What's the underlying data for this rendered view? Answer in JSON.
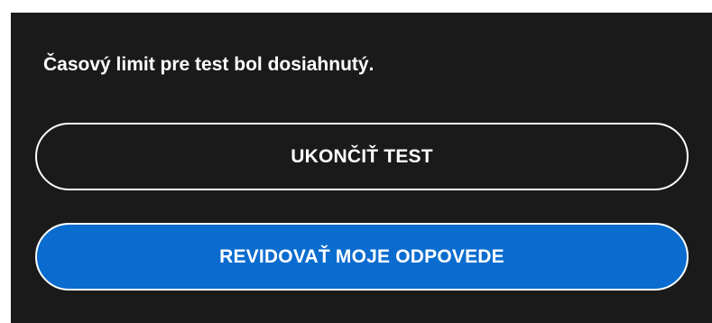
{
  "dialog": {
    "message": "Časový limit pre test bol dosiahnutý.",
    "end_test_label": "UKONČIŤ TEST",
    "review_answers_label": "REVIDOVAŤ MOJE ODPOVEDE"
  },
  "colors": {
    "panel_background": "#1a1a1a",
    "primary_button": "#0a6ccf",
    "text": "#ffffff",
    "outline": "#ffffff"
  }
}
